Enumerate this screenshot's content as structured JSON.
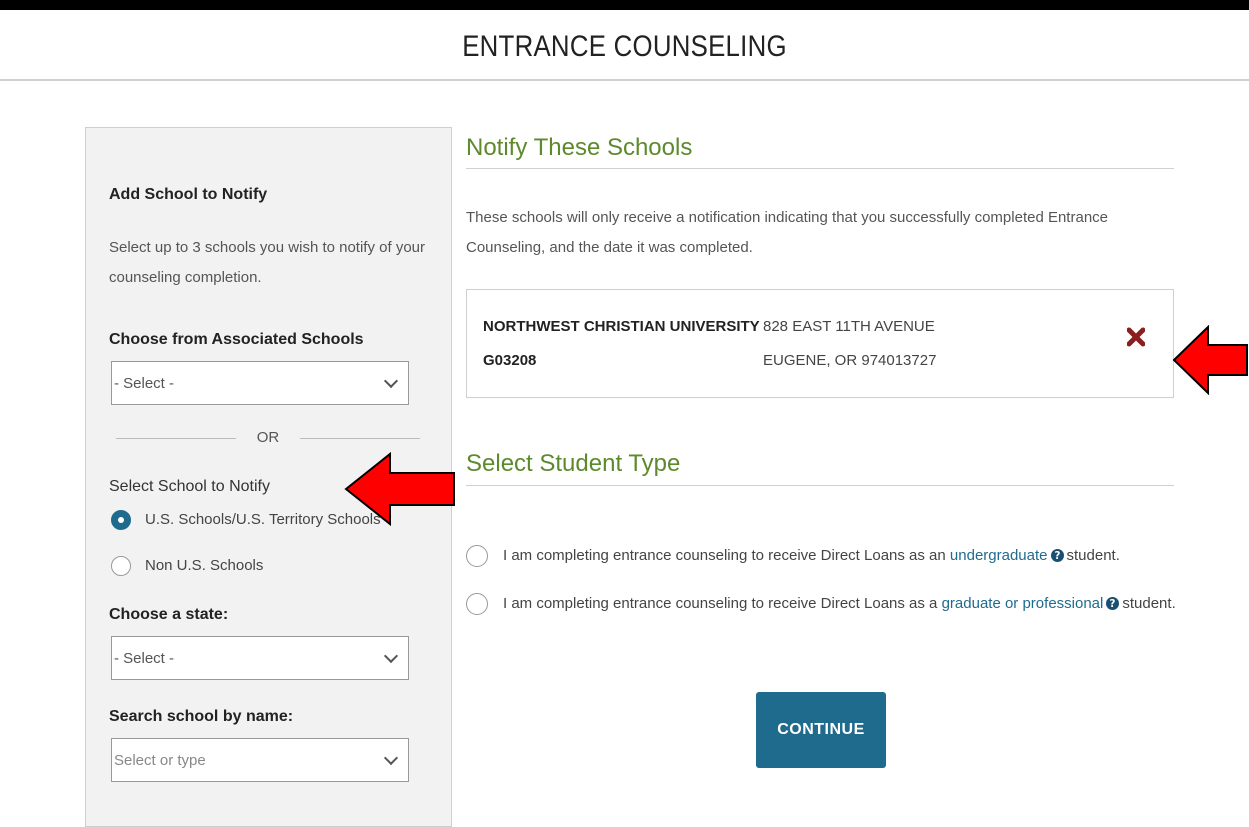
{
  "page": {
    "title": "ENTRANCE COUNSELING"
  },
  "sidebar": {
    "heading": "Add School to Notify",
    "description": "Select up to 3 schools you wish to notify of your counseling completion.",
    "associated_label": "Choose from Associated Schools",
    "associated_select_value": "- Select -",
    "or_text": "OR",
    "select_school_label": "Select School to Notify",
    "radio_us": "U.S. Schools/U.S. Territory Schools",
    "radio_non_us": "Non U.S. Schools",
    "state_label": "Choose a state:",
    "state_select_value": "- Select -",
    "search_label": "Search school by name:",
    "search_placeholder": "Select or type"
  },
  "notify": {
    "heading": "Notify These Schools",
    "description": "These schools will only receive a notification indicating that you successfully completed Entrance Counseling, and the date it was completed.",
    "school": {
      "name": "NORTHWEST CHRISTIAN UNIVERSITY",
      "code": "G03208",
      "address_line1": "828 EAST 11TH AVENUE",
      "address_line2": "EUGENE, OR 974013727"
    }
  },
  "student_type": {
    "heading": "Select Student Type",
    "option1_prefix": "I am completing entrance counseling to receive Direct Loans as an",
    "option1_link": "undergraduate",
    "option1_suffix": "student.",
    "option2_prefix": "I am completing entrance counseling to receive Direct Loans as a",
    "option2_link": "graduate or professional",
    "option2_suffix": "student."
  },
  "actions": {
    "continue_label": "CONTINUE"
  },
  "colors": {
    "accent": "#1f6b8e",
    "heading_green": "#5d8a2c",
    "remove_red": "#8b1e1e",
    "annotation_arrow": "#ff0000"
  }
}
